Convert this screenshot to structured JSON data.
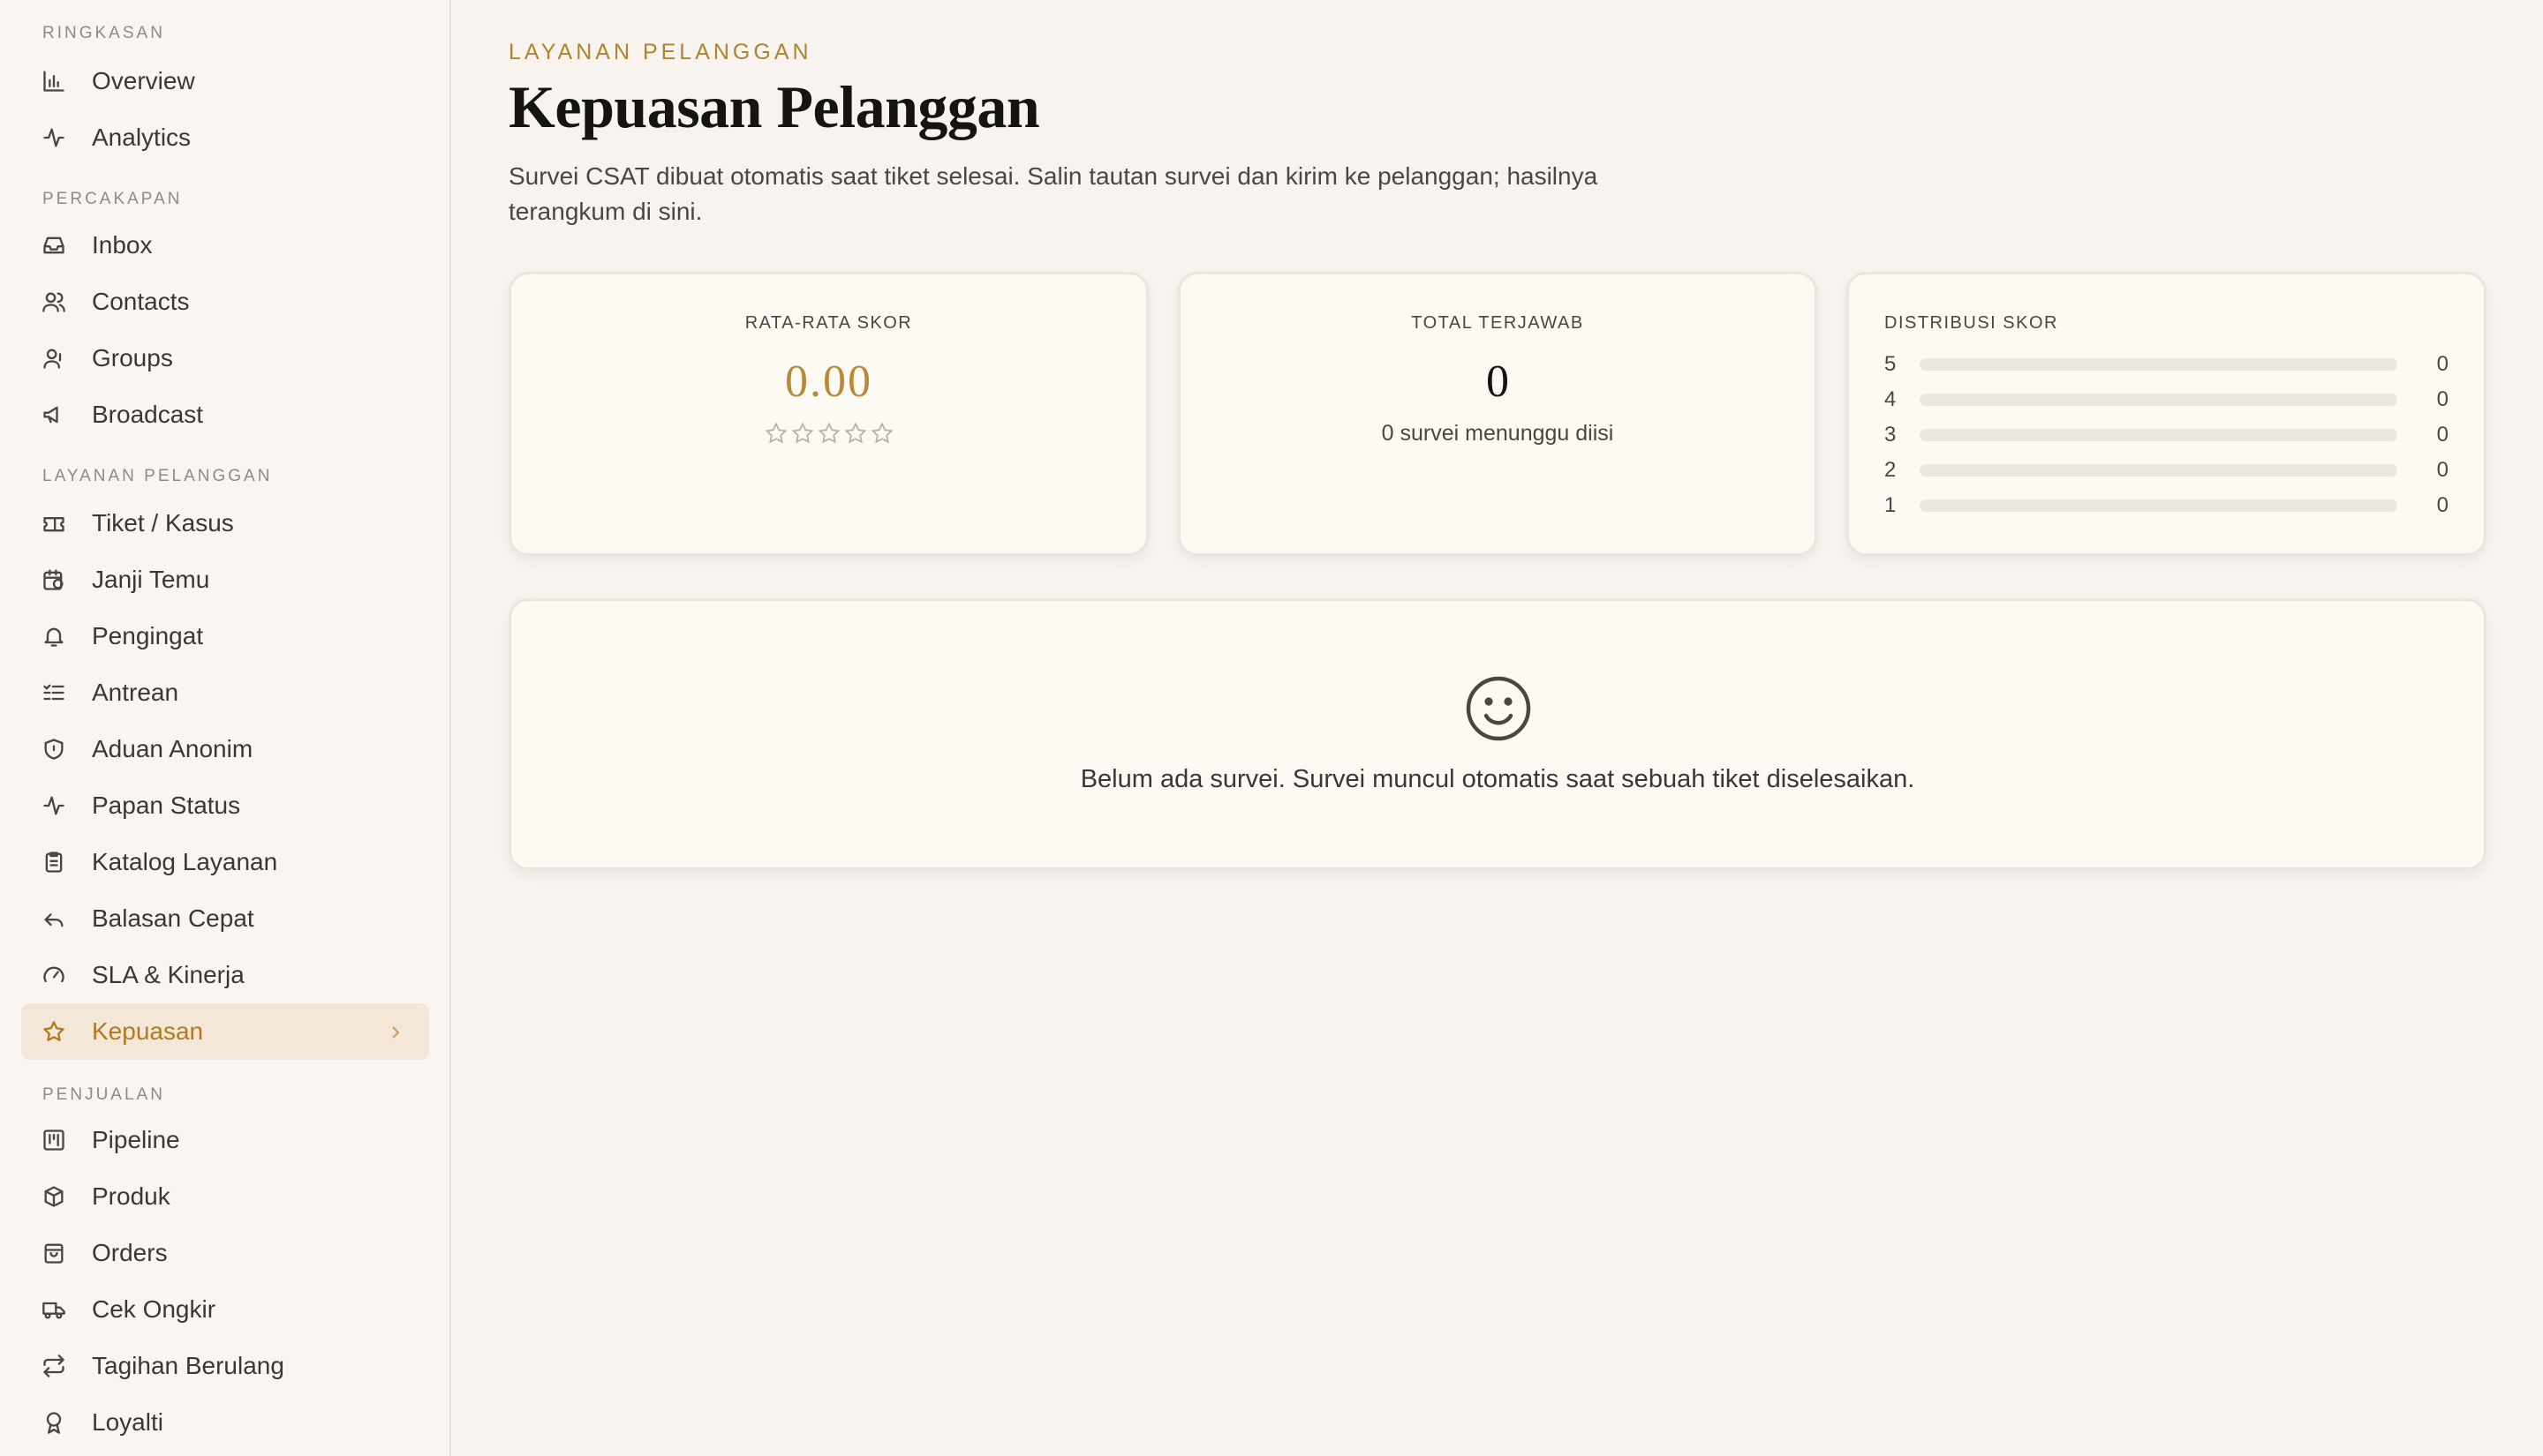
{
  "sidebar": {
    "sections": [
      {
        "label": "RINGKASAN"
      },
      {
        "label": "PERCAKAPAN"
      },
      {
        "label": "LAYANAN PELANGGAN"
      },
      {
        "label": "PENJUALAN"
      }
    ],
    "items": [
      {
        "label": "Overview",
        "icon": "bar-chart-icon"
      },
      {
        "label": "Analytics",
        "icon": "activity-icon"
      },
      {
        "label": "Inbox",
        "icon": "inbox-icon"
      },
      {
        "label": "Contacts",
        "icon": "users-icon"
      },
      {
        "label": "Groups",
        "icon": "group-icon"
      },
      {
        "label": "Broadcast",
        "icon": "megaphone-icon"
      },
      {
        "label": "Tiket / Kasus",
        "icon": "ticket-icon"
      },
      {
        "label": "Janji Temu",
        "icon": "calendar-clock-icon"
      },
      {
        "label": "Pengingat",
        "icon": "bell-icon"
      },
      {
        "label": "Antrean",
        "icon": "list-check-icon"
      },
      {
        "label": "Aduan Anonim",
        "icon": "shield-icon"
      },
      {
        "label": "Papan Status",
        "icon": "pulse-icon"
      },
      {
        "label": "Katalog Layanan",
        "icon": "clipboard-icon"
      },
      {
        "label": "Balasan Cepat",
        "icon": "reply-icon"
      },
      {
        "label": "SLA & Kinerja",
        "icon": "gauge-icon"
      },
      {
        "label": "Kepuasan",
        "icon": "star-icon",
        "active": true
      },
      {
        "label": "Pipeline",
        "icon": "kanban-icon"
      },
      {
        "label": "Produk",
        "icon": "package-icon"
      },
      {
        "label": "Orders",
        "icon": "shopping-bag-icon"
      },
      {
        "label": "Cek Ongkir",
        "icon": "truck-icon"
      },
      {
        "label": "Tagihan Berulang",
        "icon": "repeat-icon"
      },
      {
        "label": "Loyalti",
        "icon": "award-icon"
      }
    ]
  },
  "header": {
    "eyebrow": "LAYANAN PELANGGAN",
    "title": "Kepuasan Pelanggan",
    "description": "Survei CSAT dibuat otomatis saat tiket selesai. Salin tautan survei dan kirim ke pelanggan; hasilnya terangkum di sini."
  },
  "stats": {
    "average": {
      "label": "RATA-RATA SKOR",
      "value": "0.00",
      "stars_filled": 0,
      "stars_total": 5
    },
    "total": {
      "label": "TOTAL TERJAWAB",
      "value": "0",
      "sub": "0 survei menunggu diisi"
    },
    "distribution": {
      "label": "DISTRIBUSI SKOR",
      "rows": [
        {
          "score": "5",
          "count": "0"
        },
        {
          "score": "4",
          "count": "0"
        },
        {
          "score": "3",
          "count": "0"
        },
        {
          "score": "2",
          "count": "0"
        },
        {
          "score": "1",
          "count": "0"
        }
      ]
    }
  },
  "empty_state": {
    "icon": "smiley-icon",
    "text": "Belum ada survei. Survei muncul otomatis saat sebuah tiket diselesaikan."
  },
  "colors": {
    "accent": "#b0832f",
    "active_bg": "#f4e7d7",
    "background": "#f7f4ef",
    "card_bg": "#fdfaf3"
  }
}
